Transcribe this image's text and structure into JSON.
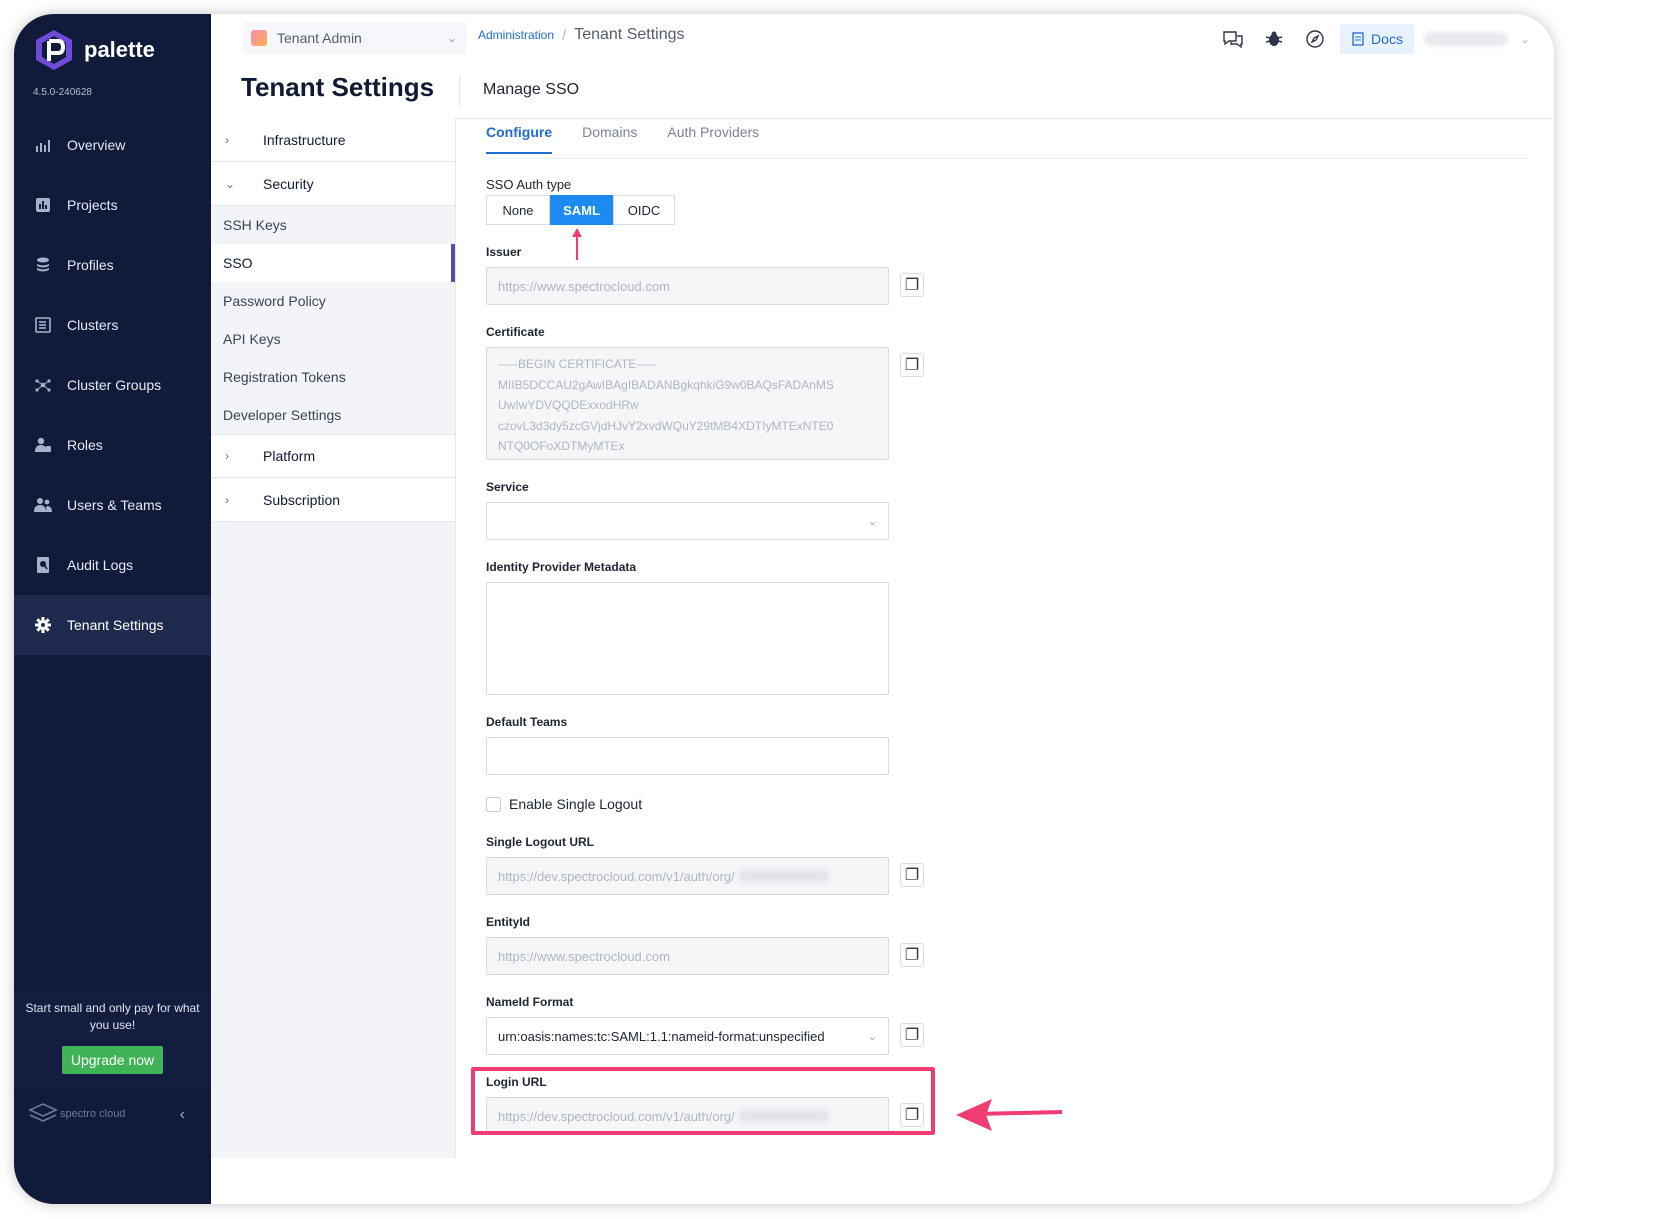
{
  "sidebar": {
    "logo_text": "palette",
    "version": "4.5.0-240628",
    "items": [
      {
        "label": "Overview",
        "icon": "chart-icon"
      },
      {
        "label": "Projects",
        "icon": "projects-icon"
      },
      {
        "label": "Profiles",
        "icon": "stack-icon"
      },
      {
        "label": "Clusters",
        "icon": "clusters-icon"
      },
      {
        "label": "Cluster Groups",
        "icon": "network-icon"
      },
      {
        "label": "Roles",
        "icon": "roles-icon"
      },
      {
        "label": "Users & Teams",
        "icon": "users-icon"
      },
      {
        "label": "Audit Logs",
        "icon": "audit-icon"
      },
      {
        "label": "Tenant Settings",
        "icon": "gear-icon"
      }
    ],
    "active": "Tenant Settings",
    "upgrade_text": "Start small and only pay for what you use!",
    "upgrade_button": "Upgrade now",
    "footer_brand": "spectro cloud"
  },
  "topbar": {
    "tenant": "Tenant Admin",
    "breadcrumb_link": "Administration",
    "breadcrumb_sep": "/",
    "breadcrumb_current": "Tenant Settings",
    "docs": "Docs"
  },
  "header": {
    "page_title": "Tenant Settings",
    "section_title": "Manage SSO"
  },
  "submenu": {
    "infrastructure": "Infrastructure",
    "security": "Security",
    "security_items": [
      "SSH Keys",
      "SSO",
      "Password Policy",
      "API Keys",
      "Registration Tokens",
      "Developer Settings"
    ],
    "active": "SSO",
    "platform": "Platform",
    "subscription": "Subscription"
  },
  "tabs": [
    "Configure",
    "Domains",
    "Auth Providers"
  ],
  "active_tab": "Configure",
  "form": {
    "auth_type_label": "SSO Auth type",
    "auth_type_options": [
      "None",
      "SAML",
      "OIDC"
    ],
    "auth_type_selected": "SAML",
    "issuer_label": "Issuer",
    "issuer_value": "https://www.spectrocloud.com",
    "certificate_label": "Certificate",
    "certificate_lines": [
      "-----BEGIN CERTIFICATE-----",
      "MIIB5DCCAU2gAwIBAgIBADANBgkqhkiG9w0BAQsFADAnMS",
      "UwIwYDVQQDExxodHRw",
      "czovL3d3dy5zcGVjdHJvY2xvdWQuY29tMB4XDTIyMTExNTE0",
      "NTQ0OFoXDTMyMTEx"
    ],
    "service_label": "Service",
    "service_value": "",
    "idp_metadata_label": "Identity Provider Metadata",
    "default_teams_label": "Default Teams",
    "enable_logout_label": "Enable Single Logout",
    "logout_url_label": "Single Logout URL",
    "logout_url_value": "https://dev.spectrocloud.com/v1/auth/org/",
    "entity_id_label": "EntityId",
    "entity_id_value": "https://www.spectrocloud.com",
    "nameid_label": "NameId Format",
    "nameid_value": "urn:oasis:names:tc:SAML:1.1:nameid-format:unspecified",
    "login_url_label": "Login URL",
    "login_url_value": "https://dev.spectrocloud.com/v1/auth/org/"
  },
  "colors": {
    "sidebar_bg": "#101a3a",
    "accent": "#1b8bf2",
    "annotation": "#ef3d73",
    "upgrade": "#3fb356"
  }
}
